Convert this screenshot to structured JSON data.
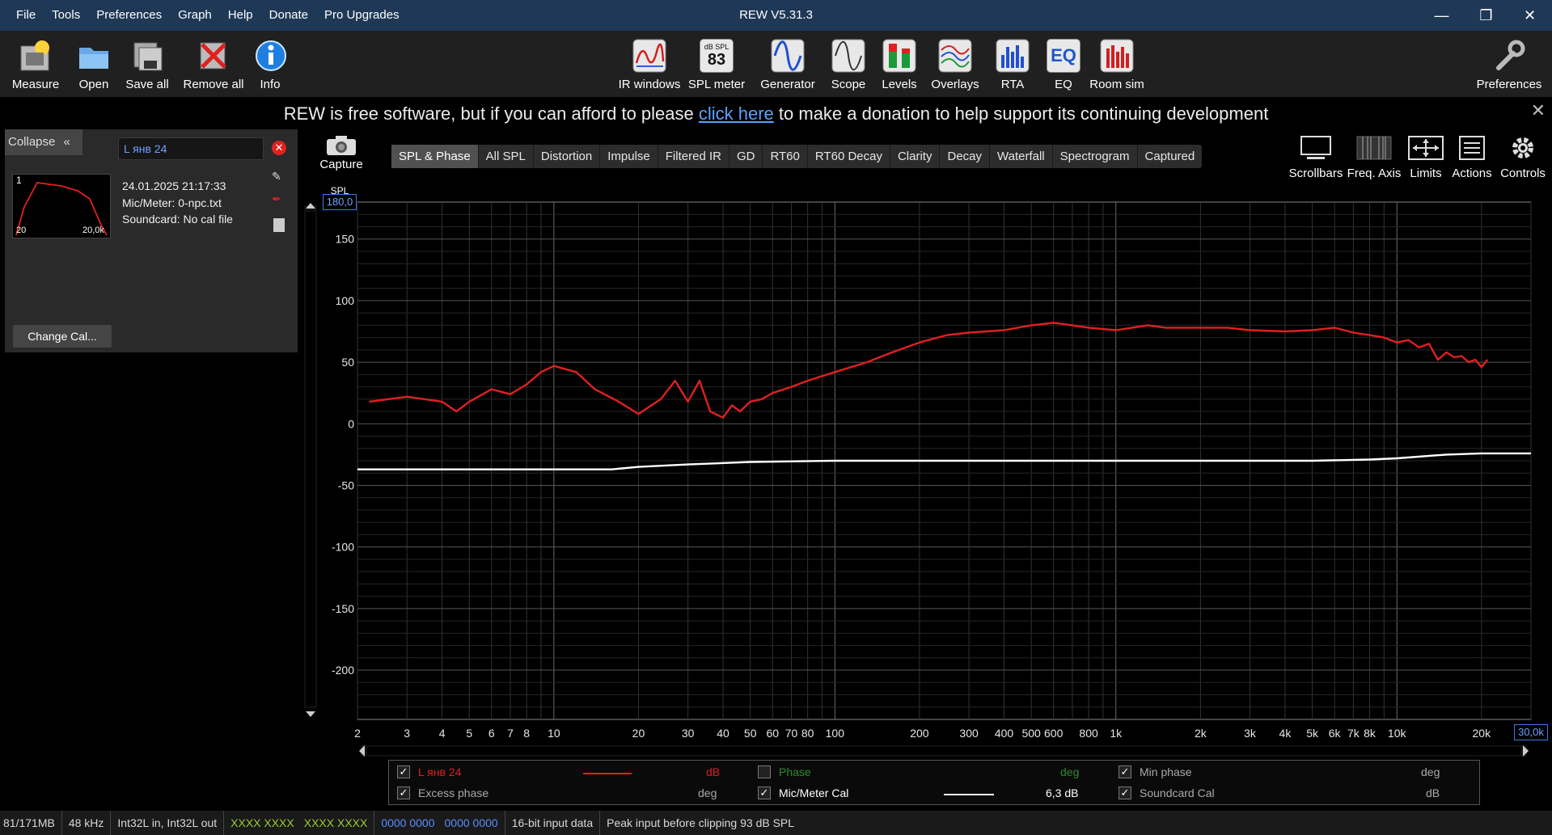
{
  "window": {
    "title": "REW V5.31.3"
  },
  "menu": [
    "File",
    "Tools",
    "Preferences",
    "Graph",
    "Help",
    "Donate",
    "Pro Upgrades"
  ],
  "toolbar_left": [
    {
      "label": "Measure",
      "icon": "microphone-measure-icon"
    },
    {
      "label": "Open",
      "icon": "folder-open-icon"
    },
    {
      "label": "Save all",
      "icon": "save-all-icon"
    },
    {
      "label": "Remove all",
      "icon": "remove-all-icon"
    },
    {
      "label": "Info",
      "icon": "info-icon"
    }
  ],
  "toolbar_center": [
    {
      "label": "IR windows",
      "icon": "ir-windows-icon"
    },
    {
      "label": "SPL meter",
      "icon": "spl-meter-icon",
      "badge_top": "dB SPL",
      "badge_value": "83"
    },
    {
      "label": "Generator",
      "icon": "generator-icon"
    },
    {
      "label": "Scope",
      "icon": "scope-icon"
    },
    {
      "label": "Levels",
      "icon": "levels-icon"
    },
    {
      "label": "Overlays",
      "icon": "overlays-icon"
    },
    {
      "label": "RTA",
      "icon": "rta-icon"
    },
    {
      "label": "EQ",
      "icon": "eq-icon"
    },
    {
      "label": "Room sim",
      "icon": "room-sim-icon"
    }
  ],
  "toolbar_right": {
    "label": "Preferences",
    "icon": "wrench-icon"
  },
  "donate_banner": {
    "before": "REW is free software, but if you can afford to please ",
    "link": "click here",
    "after": " to make a donation to help support its continuing development"
  },
  "left_panel": {
    "collapse_label": "Collapse",
    "measurement_name": "L янв 24",
    "thumb_index": "1",
    "thumb_xmin": "20",
    "thumb_xmax": "20,0k",
    "date": "24.01.2025 21:17:33",
    "mic": "Mic/Meter: 0-npc.txt",
    "soundcard": "Soundcard: No cal file",
    "change_cal": "Change Cal..."
  },
  "capture_label": "Capture",
  "graph_tabs": [
    "SPL & Phase",
    "All SPL",
    "Distortion",
    "Impulse",
    "Filtered IR",
    "GD",
    "RT60",
    "RT60 Decay",
    "Clarity",
    "Decay",
    "Waterfall",
    "Spectrogram",
    "Captured"
  ],
  "active_tab": "SPL & Phase",
  "graph_controls": [
    {
      "label": "Scrollbars",
      "icon": "scrollbars-icon"
    },
    {
      "label": "Freq. Axis",
      "icon": "freq-axis-icon"
    },
    {
      "label": "Limits",
      "icon": "limits-icon"
    },
    {
      "label": "Actions",
      "icon": "actions-icon"
    },
    {
      "label": "Controls",
      "icon": "gear-icon"
    }
  ],
  "colors": {
    "spl": "#e02020",
    "cal": "#ffffff",
    "phase": "#2e8b2e",
    "grid": "#3a3a3a",
    "accent": "#1f3856"
  },
  "chart_data": {
    "type": "line",
    "ylabel": "SPL",
    "y_top_box": "180,0",
    "x_right_box": "30,0k",
    "xscale": "log",
    "xlim": [
      2,
      30000
    ],
    "ylim": [
      -240,
      180
    ],
    "yticks": [
      150,
      100,
      50,
      0,
      -50,
      -100,
      -150,
      -200
    ],
    "xticks": [
      {
        "v": 2,
        "t": "2"
      },
      {
        "v": 3,
        "t": "3"
      },
      {
        "v": 4,
        "t": "4"
      },
      {
        "v": 5,
        "t": "5"
      },
      {
        "v": 6,
        "t": "6"
      },
      {
        "v": 7,
        "t": "7"
      },
      {
        "v": 8,
        "t": "8"
      },
      {
        "v": 10,
        "t": "10"
      },
      {
        "v": 20,
        "t": "20"
      },
      {
        "v": 30,
        "t": "30"
      },
      {
        "v": 40,
        "t": "40"
      },
      {
        "v": 50,
        "t": "50"
      },
      {
        "v": 60,
        "t": "60"
      },
      {
        "v": 70,
        "t": "70"
      },
      {
        "v": 80,
        "t": "80"
      },
      {
        "v": 100,
        "t": "100"
      },
      {
        "v": 200,
        "t": "200"
      },
      {
        "v": 300,
        "t": "300"
      },
      {
        "v": 400,
        "t": "400"
      },
      {
        "v": 500,
        "t": "500"
      },
      {
        "v": 600,
        "t": "600"
      },
      {
        "v": 800,
        "t": "800"
      },
      {
        "v": 1000,
        "t": "1k"
      },
      {
        "v": 2000,
        "t": "2k"
      },
      {
        "v": 3000,
        "t": "3k"
      },
      {
        "v": 4000,
        "t": "4k"
      },
      {
        "v": 5000,
        "t": "5k"
      },
      {
        "v": 6000,
        "t": "6k"
      },
      {
        "v": 7000,
        "t": "7k"
      },
      {
        "v": 8000,
        "t": "8k"
      },
      {
        "v": 10000,
        "t": "10k"
      },
      {
        "v": 20000,
        "t": "20k"
      }
    ],
    "series": [
      {
        "name": "L янв 24",
        "color": "#e02020",
        "x": [
          2.2,
          3,
          4,
          4.5,
          5,
          6,
          7,
          8,
          9,
          10,
          12,
          14,
          17,
          20,
          24,
          27,
          30,
          33,
          36,
          40,
          43,
          46,
          50,
          55,
          60,
          70,
          80,
          100,
          130,
          160,
          200,
          250,
          300,
          400,
          500,
          600,
          700,
          800,
          1000,
          1300,
          1500,
          2000,
          2500,
          3000,
          4000,
          5000,
          6000,
          7000,
          8000,
          9000,
          10000,
          11000,
          12000,
          13000,
          14000,
          15000,
          16000,
          17000,
          18000,
          19000,
          20000,
          21000
        ],
        "y": [
          18,
          22,
          18,
          10,
          18,
          28,
          24,
          32,
          42,
          47,
          42,
          28,
          18,
          8,
          20,
          35,
          18,
          35,
          10,
          5,
          15,
          10,
          18,
          20,
          25,
          30,
          35,
          42,
          50,
          58,
          66,
          72,
          74,
          76,
          80,
          82,
          80,
          78,
          76,
          80,
          78,
          78,
          78,
          76,
          75,
          76,
          78,
          74,
          72,
          70,
          66,
          68,
          62,
          65,
          52,
          58,
          54,
          55,
          50,
          52,
          46,
          52
        ]
      },
      {
        "name": "Mic/Meter Cal",
        "color": "#ffffff",
        "x": [
          2,
          5,
          10,
          16,
          20,
          30,
          50,
          100,
          200,
          500,
          1000,
          2000,
          5000,
          8000,
          10000,
          15000,
          20000,
          30000
        ],
        "y": [
          -37,
          -37,
          -37,
          -37,
          -35,
          -33,
          -31,
          -30,
          -30,
          -30,
          -30,
          -30,
          -30,
          -29,
          -28,
          -25,
          -24,
          -24
        ]
      }
    ]
  },
  "legend": {
    "row1": [
      {
        "label": "L янв 24",
        "unit": "dB",
        "checked": true,
        "color": "#e02020"
      },
      {
        "label": "Phase",
        "unit": "deg",
        "checked": false,
        "color": "#2e8b2e"
      },
      {
        "label": "Min phase",
        "unit": "deg",
        "checked": true,
        "color": "#aaaaaa"
      }
    ],
    "row2": [
      {
        "label": "Excess phase",
        "unit": "deg",
        "checked": true,
        "color": "#aaaaaa"
      },
      {
        "label": "Mic/Meter Cal",
        "unit": "dB",
        "value": "6,3",
        "checked": true,
        "color": "#ffffff"
      },
      {
        "label": "Soundcard Cal",
        "unit": "dB",
        "checked": true,
        "color": "#aaaaaa"
      }
    ]
  },
  "status": {
    "memory": "81/171MB",
    "rate": "48 kHz",
    "format": "Int32L in, Int32L out",
    "inputs_green1": "XXXX XXXX",
    "inputs_green2": "XXXX XXXX",
    "outputs_blue1": "0000 0000",
    "outputs_blue2": "0000 0000",
    "bitdepth": "16-bit input data",
    "peak": "Peak input before clipping 93 dB SPL"
  }
}
